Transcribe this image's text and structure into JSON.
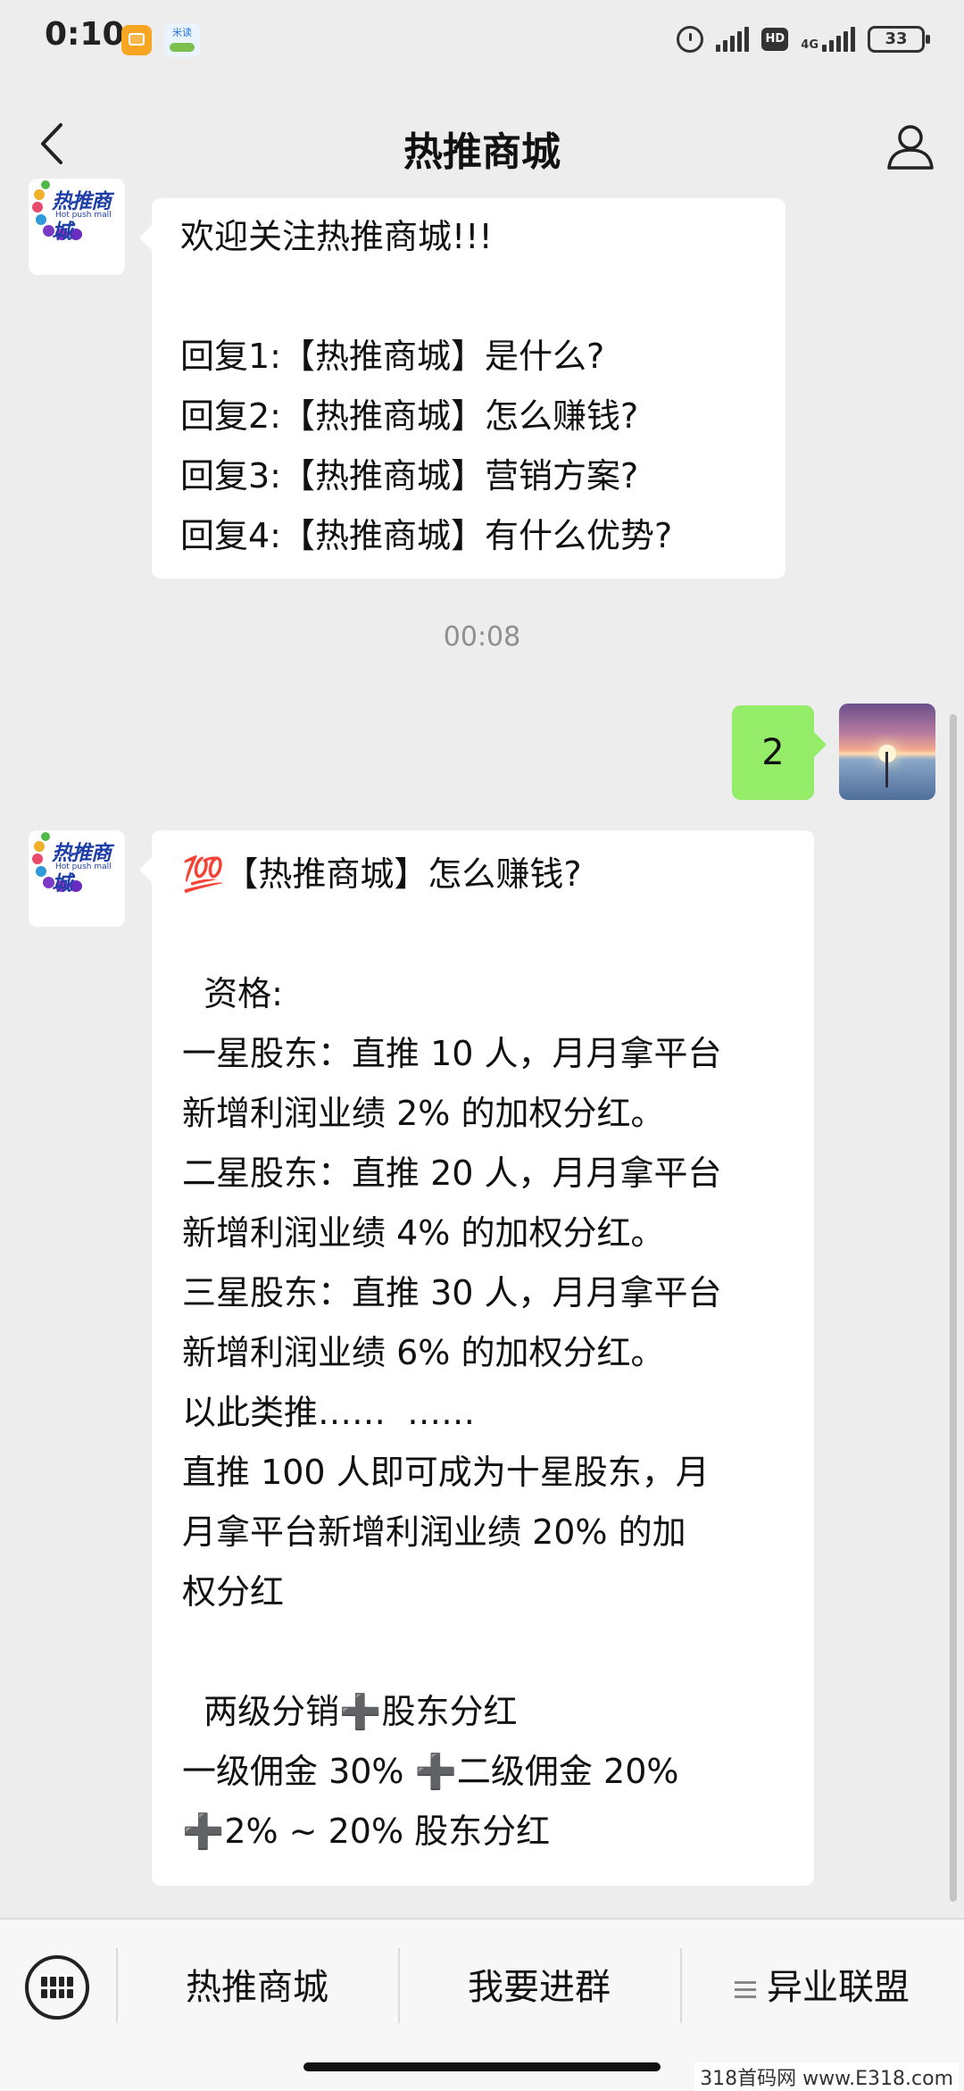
{
  "status_bar": {
    "time": "0:10",
    "app_badge": "米读",
    "network": "4G",
    "battery": "33"
  },
  "header": {
    "title": "热推商城"
  },
  "messages": [
    {
      "side": "left",
      "avatar": {
        "logo_cn": "热推商城",
        "logo_en": "Hot push mall"
      },
      "lines": [
        "欢迎关注热推商城!!!",
        "",
        "回复1:【热推商城】是什么?",
        "回复2:【热推商城】怎么赚钱?",
        "回复3:【热推商城】营销方案?",
        "回复4:【热推商城】有什么优势?"
      ]
    },
    {
      "type": "timestamp",
      "text": "00:08"
    },
    {
      "side": "right",
      "text": "2"
    },
    {
      "side": "left",
      "avatar": {
        "logo_cn": "热推商城",
        "logo_en": "Hot push mall"
      },
      "lines": [
        "💯【热推商城】怎么赚钱?",
        "",
        "  资格:",
        "一星股东：直推 10 人，月月拿平台",
        "新增利润业绩 2% 的加权分红。",
        "二星股东：直推 20 人，月月拿平台",
        "新增利润业绩 4% 的加权分红。",
        "三星股东：直推 30 人，月月拿平台",
        "新增利润业绩 6% 的加权分红。",
        "以此类推……  ……",
        "直推 100 人即可成为十星股东，月",
        "月拿平台新增利润业绩 20% 的加",
        "权分红",
        "",
        "  两级分销➕股东分红",
        "一级佣金 30% ➕二级佣金 20%",
        "➕2% ~ 20% 股东分红"
      ]
    }
  ],
  "bottom_menu": {
    "items": [
      "热推商城",
      "我要进群",
      "异业联盟"
    ]
  },
  "watermark": "318首码网  www.E318.com"
}
